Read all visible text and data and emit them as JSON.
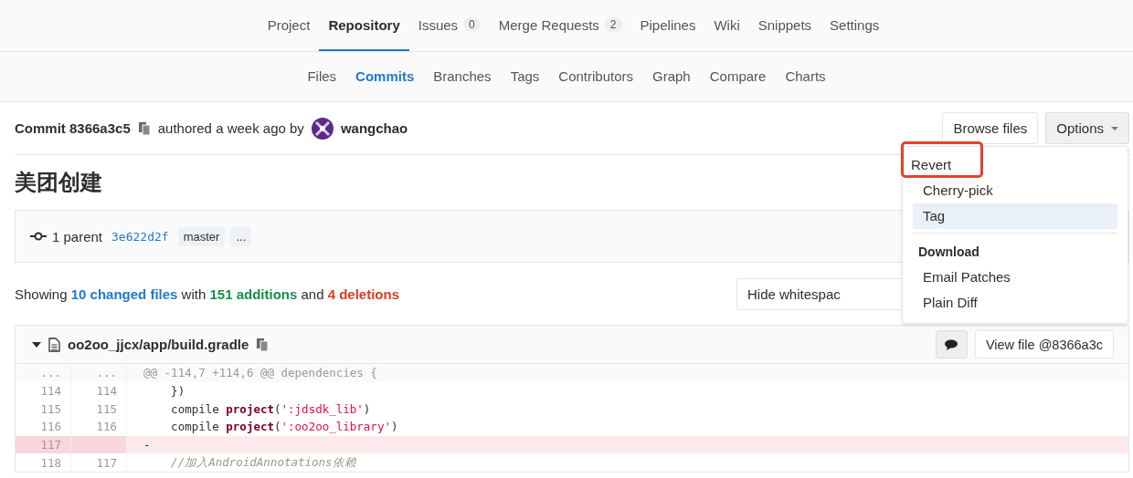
{
  "nav": {
    "tabs": [
      {
        "label": "Project",
        "selected": false
      },
      {
        "label": "Repository",
        "selected": true
      },
      {
        "label": "Issues",
        "count": "0",
        "selected": false
      },
      {
        "label": "Merge Requests",
        "count": "2",
        "selected": false
      },
      {
        "label": "Pipelines",
        "selected": false
      },
      {
        "label": "Wiki",
        "selected": false
      },
      {
        "label": "Snippets",
        "selected": false
      },
      {
        "label": "Settings",
        "selected": false
      }
    ]
  },
  "subnav": {
    "tabs": [
      {
        "label": "Files",
        "selected": false
      },
      {
        "label": "Commits",
        "selected": true
      },
      {
        "label": "Branches",
        "selected": false
      },
      {
        "label": "Tags",
        "selected": false
      },
      {
        "label": "Contributors",
        "selected": false
      },
      {
        "label": "Graph",
        "selected": false
      },
      {
        "label": "Compare",
        "selected": false
      },
      {
        "label": "Charts",
        "selected": false
      }
    ]
  },
  "commit": {
    "title": "Commit 8366a3c5",
    "authored": "authored a week ago by",
    "author": "wangchao",
    "message": "美团创建",
    "parent_label": "1 parent",
    "parent_sha": "3e622d2f",
    "refs": [
      "master",
      "..."
    ]
  },
  "buttons": {
    "browse": "Browse files",
    "options": "Options",
    "hide_whitespace": "Hide whitespac"
  },
  "options_menu": {
    "items": [
      {
        "label": "Revert",
        "kind": "item",
        "hovered": false,
        "highlighted": true
      },
      {
        "label": "Cherry-pick",
        "kind": "item",
        "hovered": false,
        "highlighted": false
      },
      {
        "label": "Tag",
        "kind": "item",
        "hovered": true,
        "highlighted": false
      },
      {
        "kind": "divider"
      },
      {
        "label": "Download",
        "kind": "header"
      },
      {
        "label": "Email Patches",
        "kind": "item",
        "hovered": false,
        "highlighted": false
      },
      {
        "label": "Plain Diff",
        "kind": "item",
        "hovered": false,
        "highlighted": false
      }
    ]
  },
  "stats": {
    "prefix": "Showing",
    "files": "10 changed files",
    "with": "with",
    "additions": "151 additions",
    "and": "and",
    "deletions": "4 deletions"
  },
  "diff_file": {
    "path": "oo2oo_jjcx/app/build.gradle",
    "expanded": true,
    "view_button": "View file @8366a3c",
    "lines": [
      {
        "kind": "match",
        "old": "...",
        "new": "...",
        "tokens": [
          {
            "kind": "meta",
            "text": "@@ -114,7 +114,6 @@ dependencies {"
          }
        ]
      },
      {
        "kind": "context",
        "old": "114",
        "new": "114",
        "tokens": [
          {
            "kind": "plain",
            "text": "    })"
          }
        ]
      },
      {
        "kind": "context",
        "old": "115",
        "new": "115",
        "tokens": [
          {
            "kind": "plain",
            "text": "    compile "
          },
          {
            "kind": "keyword",
            "text": "project"
          },
          {
            "kind": "plain",
            "text": "("
          },
          {
            "kind": "string",
            "text": "':jdsdk_lib'"
          },
          {
            "kind": "plain",
            "text": ")"
          }
        ]
      },
      {
        "kind": "context",
        "old": "116",
        "new": "116",
        "tokens": [
          {
            "kind": "plain",
            "text": "    compile "
          },
          {
            "kind": "keyword",
            "text": "project"
          },
          {
            "kind": "plain",
            "text": "("
          },
          {
            "kind": "string",
            "text": "':oo2oo_library'"
          },
          {
            "kind": "plain",
            "text": ")"
          }
        ]
      },
      {
        "kind": "removed",
        "old": "117",
        "tokens": [
          {
            "kind": "plain",
            "text": "-"
          }
        ]
      },
      {
        "kind": "context",
        "old": "118",
        "new": "117",
        "tokens": [
          {
            "kind": "comment",
            "text": "    //加入AndroidAnnotations依赖"
          }
        ]
      }
    ]
  }
}
